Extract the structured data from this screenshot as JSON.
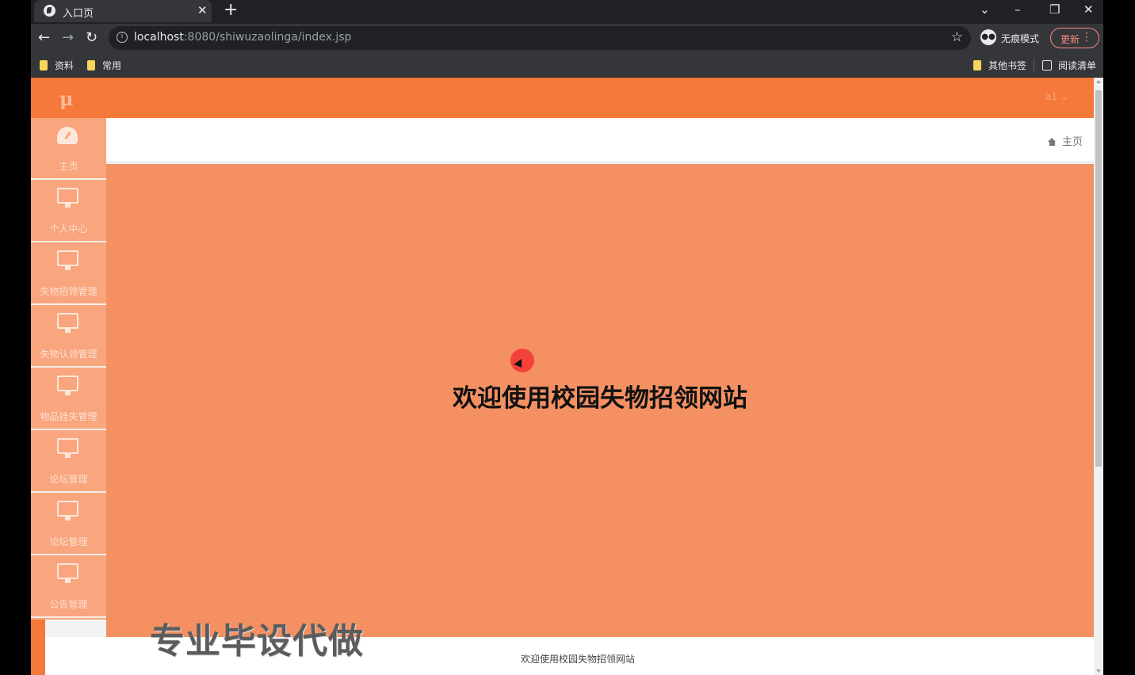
{
  "browser": {
    "tab_title": "入口页",
    "tab_close": "✕",
    "new_tab": "+",
    "url_host": "localhost",
    "url_rest": ":8080/shiwuzaolinga/index.jsp",
    "incognito_label": "无痕模式",
    "update_label": "更新",
    "bookmarks": [
      "资料",
      "常用"
    ],
    "other_bookmarks": "其他书签",
    "reading_list": "阅读清单"
  },
  "app": {
    "logo": "μ",
    "user_menu": "a1 ⌄",
    "breadcrumb_home": "主页",
    "sidebar": {
      "items": [
        {
          "label": "主页",
          "icon": "dashboard-icon"
        },
        {
          "label": "个人中心",
          "icon": "monitor-icon"
        },
        {
          "label": "失物招领管理",
          "icon": "monitor-icon"
        },
        {
          "label": "失物认领管理",
          "icon": "monitor-icon"
        },
        {
          "label": "物品挂失管理",
          "icon": "monitor-icon"
        },
        {
          "label": "论坛管理",
          "icon": "monitor-icon"
        },
        {
          "label": "论坛管理",
          "icon": "monitor-icon"
        },
        {
          "label": "公告管理",
          "icon": "monitor-icon"
        }
      ]
    },
    "welcome_heading": "欢迎使用校园失物招领网站",
    "footer_text": "欢迎使用校园失物招领网站",
    "overlay_watermark": "专业毕设代做"
  }
}
